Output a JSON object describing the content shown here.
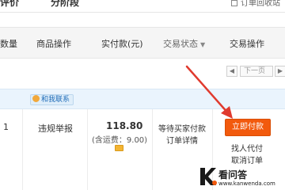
{
  "top": {
    "tab1": "评价",
    "tab2": "分阶段",
    "recycle": "订单回收站"
  },
  "table_header": {
    "quantity": "数量",
    "product_ops": "商品操作",
    "paid_amount": "实付款(元)",
    "trade_status": "交易状态",
    "trade_ops": "交易操作"
  },
  "pager": {
    "prev": "◀",
    "box": "下一页",
    "next": "▶"
  },
  "order": {
    "contact": "和我联系",
    "quantity": "1",
    "report": "违规举报",
    "price": "118.80",
    "shipping": "(含运费：9.00)",
    "status": "等待买家付款",
    "detail": "订单详情",
    "pay_now": "立即付款",
    "proxy_pay": "找人代付",
    "cancel": "取消订单"
  },
  "watermark": {
    "cn": "看问答",
    "en": "www.kanwenda.com"
  },
  "colors": {
    "accent": "#f25a0d",
    "header_bg": "#f5f5f5",
    "band_bg": "#eaf4fd",
    "arrow": "#e03a2e"
  },
  "icons": [
    "recycle-bin-icon",
    "caret-down-icon",
    "contact-icon",
    "pay-card-icon",
    "annotation-arrow",
    "watermark-logo"
  ]
}
